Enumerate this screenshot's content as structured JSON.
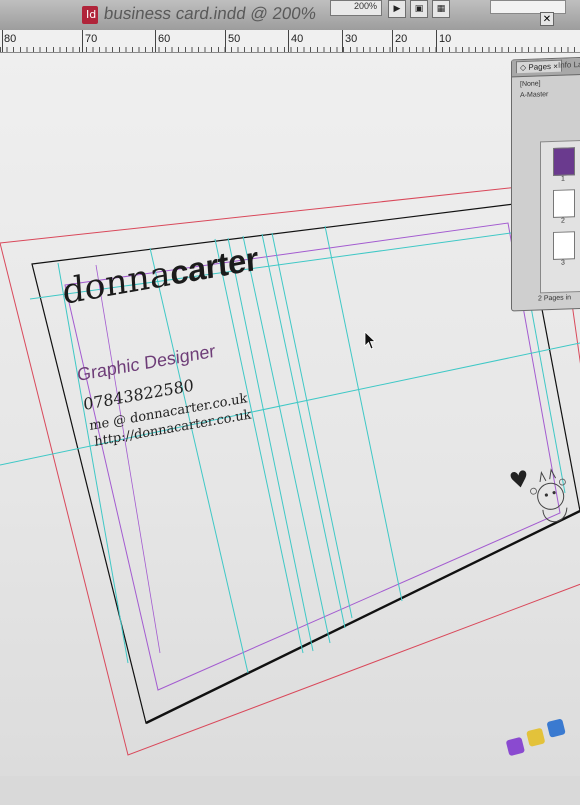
{
  "window": {
    "title": "business card.indd @ 200%",
    "app_icon_glyph": "Id",
    "zoom": "200%"
  },
  "toolbar": {
    "btn_play": "▶",
    "btn_view": "▣",
    "btn_screen": "▦",
    "close_glyph": "✕"
  },
  "ruler": {
    "labels": [
      "80",
      "70",
      "60",
      "50",
      "40",
      "30",
      "20",
      "10"
    ]
  },
  "card": {
    "name_first": "donna",
    "name_last": "carter",
    "role": "Graphic Designer",
    "phone": "07843822580",
    "email": "me @ donnacarter.co.uk",
    "website": "http://donnacarter.co.uk"
  },
  "pages_panel": {
    "tab_pages": "◇ Pages ×",
    "tab_other": "Info  Lay",
    "none_label": "[None]",
    "master_label": "A-Master",
    "page_1": "1",
    "page_2": "2",
    "page_3": "3",
    "footer": "2 Pages in"
  },
  "colors": {
    "bleed": "#d9485a",
    "margin": "#a35bd0",
    "guide": "#3fc8c6",
    "trim": "#111111",
    "selected_page": "#6a3a8e"
  }
}
